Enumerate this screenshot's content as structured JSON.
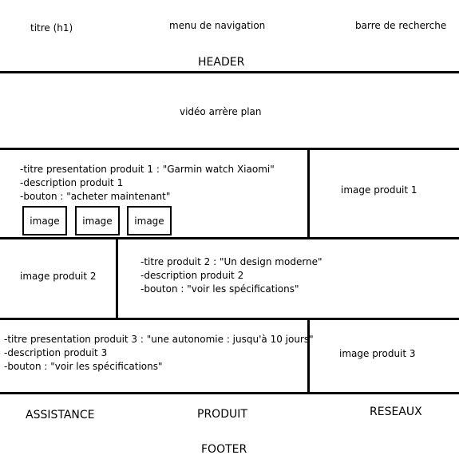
{
  "header": {
    "title": "titre (h1)",
    "nav": "menu de navigation",
    "search": "barre de recherche",
    "label": "HEADER"
  },
  "video": {
    "label": "vidéo arrère plan"
  },
  "product1": {
    "lines": [
      "-titre presentation produit 1 : \"Garmin watch Xiaomi\"",
      "-description produit 1",
      "-bouton : \"acheter maintenant\""
    ],
    "thumbnails": [
      "image",
      "image",
      "image"
    ],
    "image": "image produit 1"
  },
  "product2": {
    "image": "image produit 2",
    "lines": [
      "-titre produit 2 : \"Un design moderne\"",
      "-description produit 2",
      "-bouton : \"voir les spécifications\""
    ]
  },
  "product3": {
    "lines": [
      "-titre presentation produit 3 : \"une autonomie : jusqu'à 10 jours\"",
      "-description produit 3",
      "-bouton : \"voir les spécifications\""
    ],
    "image": "image produit 3"
  },
  "footer": {
    "assistance": "ASSISTANCE",
    "produit": "PRODUIT",
    "reseaux": "RESEAUX",
    "label": "FOOTER"
  }
}
